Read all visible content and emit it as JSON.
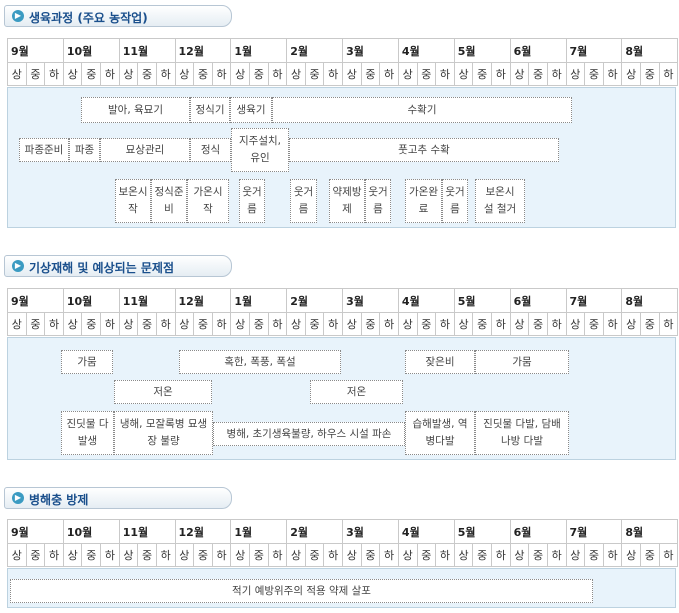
{
  "sections": [
    {
      "title": "생육과정 (주요 농작업)"
    },
    {
      "title": "기상재해 및 예상되는 문제점"
    },
    {
      "title": "병해충 방제"
    }
  ],
  "months": [
    "9월",
    "10월",
    "11월",
    "12월",
    "1월",
    "2월",
    "3월",
    "4월",
    "5월",
    "6월",
    "7월",
    "8월"
  ],
  "dekads": [
    "상",
    "중",
    "하"
  ],
  "growth": {
    "row1": [
      "발아, 육묘기",
      "정식기",
      "생육기",
      "수확기"
    ],
    "row2": [
      "파종준비",
      "파종",
      "묘상관리",
      "정식",
      "지주설치, 유인",
      "풋고추 수확"
    ],
    "row3": [
      "보온시작",
      "정식준비",
      "가온시작",
      "웃거름",
      "웃거름",
      "약제방제",
      "웃거름",
      "가온완료",
      "웃거름",
      "보온시설 철거"
    ]
  },
  "weather": {
    "row1": [
      "가뭄",
      "혹한, 폭풍, 폭설",
      "잦은비",
      "가뭄"
    ],
    "row2": [
      "저온",
      "저온"
    ],
    "row3": [
      "진딧물 다발생",
      "냉해, 모잘록병 묘생장 불량",
      "병해, 초기생육불량, 하우스 시설 파손",
      "습해발생, 역병다발",
      "진딧물 다발, 담배나방 다발"
    ]
  },
  "pest": {
    "row1": [
      "적기 예방위주의 적용 약제 살포"
    ]
  }
}
